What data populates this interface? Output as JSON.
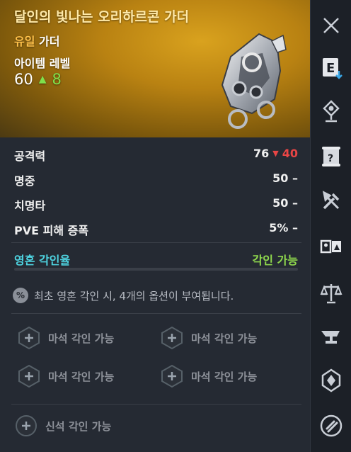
{
  "item": {
    "name": "달인의 빛나는 오리하르콘 가더",
    "grade": "유일",
    "type": "가더",
    "level_label": "아이템 레벨",
    "level": "60",
    "level_gain": "8"
  },
  "stats": [
    {
      "name": "공격력",
      "value": "76",
      "delta": "40"
    },
    {
      "name": "명중",
      "value": "50 –",
      "delta": ""
    },
    {
      "name": "치명타",
      "value": "50 –",
      "delta": ""
    },
    {
      "name": "PVE 피해 증폭",
      "value": "5% –",
      "delta": ""
    }
  ],
  "soul": {
    "label": "영혼 각인율",
    "status": "각인 가능",
    "notice": "최초 영혼 각인 시, 4개의 옵션이 부여됩니다.",
    "notice_icon_text": "%"
  },
  "slots": [
    {
      "label": "마석 각인 가능"
    },
    {
      "label": "마석 각인 가능"
    },
    {
      "label": "마석 각인 가능"
    },
    {
      "label": "마석 각인 가능"
    },
    {
      "label": "신석 각인 가능"
    }
  ],
  "sidebar": {
    "icons": [
      "close-icon",
      "equip-e-icon",
      "map-pin-icon",
      "scroll-icon",
      "crafting-tools-icon",
      "compare-icon",
      "scales-icon",
      "anvil-icon",
      "soul-crystal-icon",
      "link-icon"
    ],
    "equip_letter": "E"
  },
  "colors": {
    "header_gold": "#c9921a",
    "title": "#ffe9a8",
    "grade": "#ffc14a",
    "soul": "#4ed3e0",
    "available": "#8fd84d",
    "decrease": "#e84545",
    "increase": "#7fe04b"
  }
}
